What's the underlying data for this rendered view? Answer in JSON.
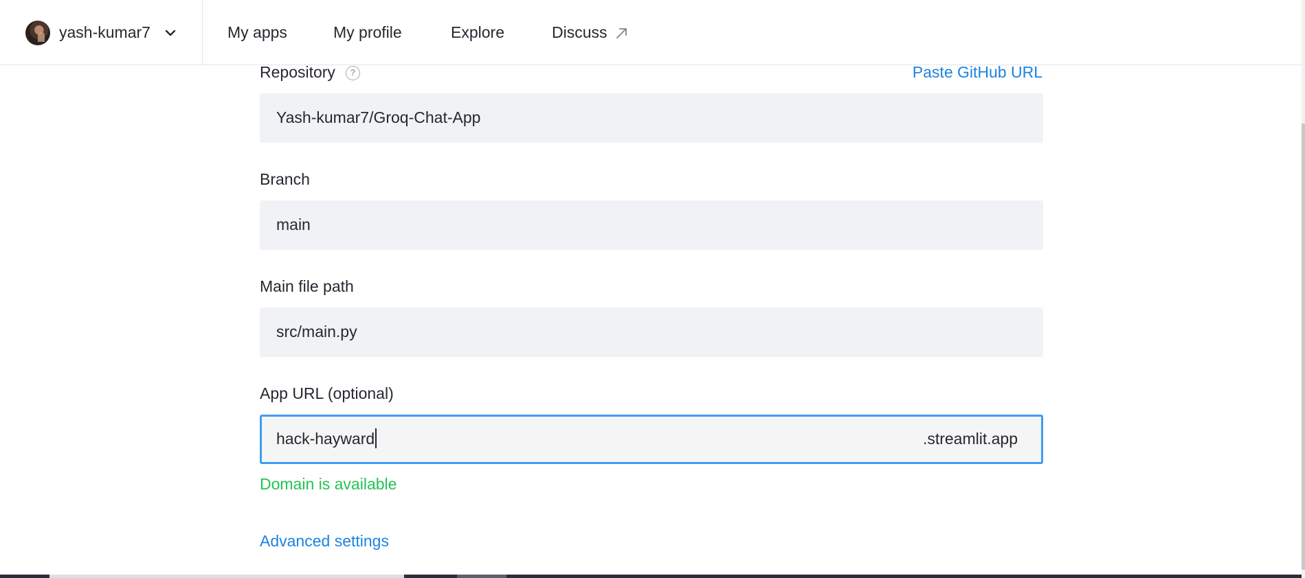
{
  "header": {
    "username": "yash-kumar7",
    "nav": {
      "my_apps": "My apps",
      "my_profile": "My profile",
      "explore": "Explore",
      "discuss": "Discuss"
    },
    "icons": {
      "avatar": "avatar",
      "user_menu": "chevron-down-icon",
      "discuss_external": "external-link-arrow-icon"
    }
  },
  "form": {
    "repository": {
      "label": "Repository",
      "help_icon": "?",
      "paste_link": "Paste GitHub URL",
      "value": "Yash-kumar7/Groq-Chat-App"
    },
    "branch": {
      "label": "Branch",
      "value": "main"
    },
    "main_file_path": {
      "label": "Main file path",
      "value": "src/main.py"
    },
    "app_url": {
      "label": "App URL (optional)",
      "value": "hack-hayward",
      "suffix": ".streamlit.app",
      "status": "Domain is available"
    },
    "advanced_settings": "Advanced settings"
  },
  "colors": {
    "link": "#1c83e1",
    "success": "#21c354",
    "focus_border": "#3d9df3",
    "input_background": "#f0f2f6"
  }
}
